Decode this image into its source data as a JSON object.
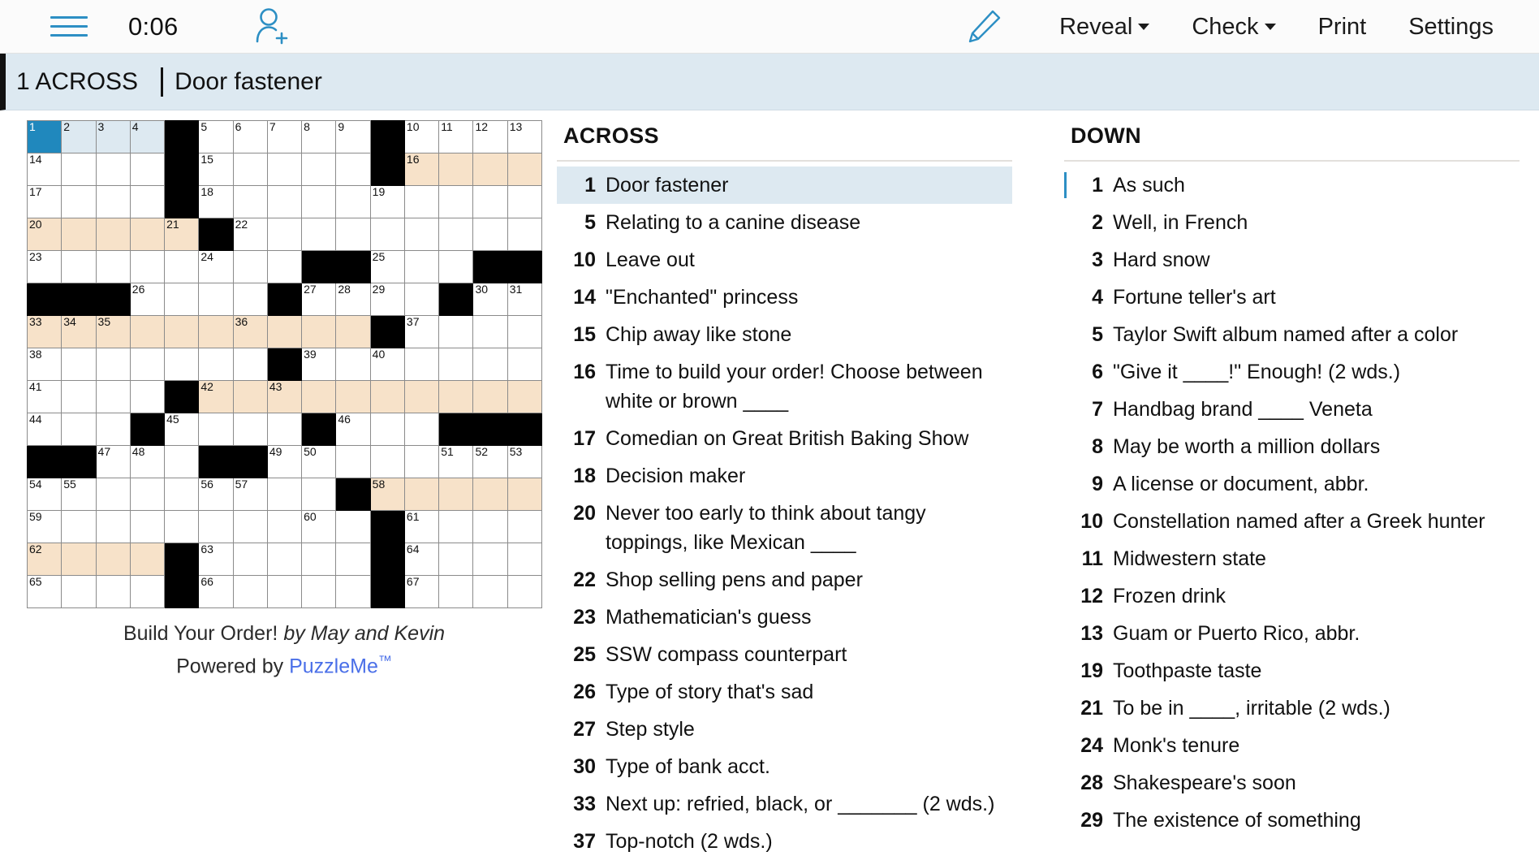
{
  "toolbar": {
    "menu_icon": "hamburger-menu-icon",
    "timer": "0:06",
    "invite_icon": "add-person-icon",
    "pencil_icon": "pencil-icon",
    "reveal_label": "Reveal",
    "check_label": "Check",
    "print_label": "Print",
    "settings_label": "Settings"
  },
  "clue_bar": {
    "number": "1 ACROSS",
    "text": "Door fastener"
  },
  "grid": {
    "rows": 15,
    "cols": 15,
    "colors": {
      "block": "#000000",
      "shade": "#f7e2c9",
      "highlight": "#dde9f1",
      "cursor": "#2088bd"
    },
    "cells": [
      [
        {
          "n": "1",
          "s": "cur"
        },
        {
          "n": "2",
          "s": "hl"
        },
        {
          "n": "3",
          "s": "hl"
        },
        {
          "n": "4",
          "s": "hl"
        },
        {
          "s": "block"
        },
        {
          "n": "5"
        },
        {
          "n": "6"
        },
        {
          "n": "7"
        },
        {
          "n": "8"
        },
        {
          "n": "9"
        },
        {
          "s": "block"
        },
        {
          "n": "10"
        },
        {
          "n": "11"
        },
        {
          "n": "12"
        },
        {
          "n": "13"
        }
      ],
      [
        {
          "n": "14"
        },
        {},
        {},
        {},
        {
          "s": "block"
        },
        {
          "n": "15"
        },
        {},
        {},
        {},
        {},
        {
          "s": "block"
        },
        {
          "n": "16",
          "s": "shade"
        },
        {
          "s": "shade"
        },
        {
          "s": "shade"
        },
        {
          "s": "shade"
        }
      ],
      [
        {
          "n": "17"
        },
        {},
        {},
        {},
        {
          "s": "block"
        },
        {
          "n": "18"
        },
        {},
        {},
        {},
        {},
        {
          "n": "19"
        },
        {},
        {},
        {},
        {}
      ],
      [
        {
          "n": "20",
          "s": "shade"
        },
        {
          "s": "shade"
        },
        {
          "s": "shade"
        },
        {
          "s": "shade"
        },
        {
          "n": "21",
          "s": "shade"
        },
        {
          "s": "block"
        },
        {
          "n": "22"
        },
        {},
        {},
        {},
        {},
        {},
        {},
        {},
        {}
      ],
      [
        {
          "n": "23"
        },
        {},
        {},
        {},
        {},
        {
          "n": "24"
        },
        {},
        {},
        {
          "s": "block"
        },
        {
          "s": "block"
        },
        {
          "n": "25"
        },
        {},
        {},
        {
          "s": "block"
        },
        {
          "s": "block"
        }
      ],
      [
        {
          "s": "block"
        },
        {
          "s": "block"
        },
        {
          "s": "block"
        },
        {
          "n": "26"
        },
        {},
        {},
        {},
        {
          "s": "block"
        },
        {
          "n": "27"
        },
        {
          "n": "28"
        },
        {
          "n": "29"
        },
        {},
        {
          "s": "block"
        },
        {
          "n": "30"
        },
        {
          "n": "31"
        }
      ],
      [
        {
          "n": "33",
          "s": "shade"
        },
        {
          "n": "34",
          "s": "shade"
        },
        {
          "n": "35",
          "s": "shade"
        },
        {
          "s": "shade"
        },
        {
          "s": "shade"
        },
        {
          "s": "shade"
        },
        {
          "n": "36",
          "s": "shade"
        },
        {
          "s": "shade"
        },
        {
          "s": "shade"
        },
        {
          "s": "shade"
        },
        {
          "s": "block"
        },
        {
          "n": "37"
        },
        {},
        {},
        {}
      ],
      [
        {
          "n": "38"
        },
        {},
        {},
        {},
        {},
        {},
        {},
        {
          "s": "block"
        },
        {
          "n": "39"
        },
        {},
        {
          "n": "40"
        },
        {},
        {},
        {},
        {}
      ],
      [
        {
          "n": "41"
        },
        {},
        {},
        {},
        {
          "s": "block"
        },
        {
          "n": "42",
          "s": "shade"
        },
        {
          "s": "shade"
        },
        {
          "n": "43",
          "s": "shade"
        },
        {
          "s": "shade"
        },
        {
          "s": "shade"
        },
        {
          "s": "shade"
        },
        {
          "s": "shade"
        },
        {
          "s": "shade"
        },
        {
          "s": "shade"
        },
        {
          "s": "shade"
        }
      ],
      [
        {
          "n": "44"
        },
        {},
        {},
        {
          "s": "block"
        },
        {
          "n": "45"
        },
        {},
        {},
        {},
        {
          "s": "block"
        },
        {
          "n": "46"
        },
        {},
        {},
        {
          "s": "block"
        },
        {
          "s": "block"
        },
        {
          "s": "block"
        }
      ],
      [
        {
          "s": "block"
        },
        {
          "s": "block"
        },
        {
          "n": "47"
        },
        {
          "n": "48"
        },
        {},
        {
          "s": "block"
        },
        {
          "s": "block"
        },
        {
          "n": "49"
        },
        {
          "n": "50"
        },
        {},
        {},
        {},
        {
          "n": "51"
        },
        {
          "n": "52"
        },
        {
          "n": "53"
        }
      ],
      [
        {
          "n": "54"
        },
        {
          "n": "55"
        },
        {},
        {},
        {},
        {
          "n": "56"
        },
        {
          "n": "57"
        },
        {},
        {},
        {
          "s": "block"
        },
        {
          "n": "58",
          "s": "shade"
        },
        {
          "s": "shade"
        },
        {
          "s": "shade"
        },
        {
          "s": "shade"
        },
        {
          "s": "shade"
        }
      ],
      [
        {
          "n": "59"
        },
        {},
        {},
        {},
        {},
        {},
        {},
        {},
        {
          "n": "60"
        },
        {},
        {
          "s": "block"
        },
        {
          "n": "61"
        },
        {},
        {},
        {}
      ],
      [
        {
          "n": "62",
          "s": "shade"
        },
        {
          "s": "shade"
        },
        {
          "s": "shade"
        },
        {
          "s": "shade"
        },
        {
          "s": "block"
        },
        {
          "n": "63"
        },
        {},
        {},
        {},
        {},
        {
          "s": "block"
        },
        {
          "n": "64"
        },
        {},
        {},
        {}
      ],
      [
        {
          "n": "65"
        },
        {},
        {},
        {},
        {
          "s": "block"
        },
        {
          "n": "66"
        },
        {},
        {},
        {},
        {},
        {
          "s": "block"
        },
        {
          "n": "67"
        },
        {},
        {},
        {}
      ]
    ]
  },
  "caption": {
    "title": "Build Your Order!",
    "byline": "by May and Kevin",
    "powered_prefix": "Powered by ",
    "powered_brand": "PuzzleMe",
    "trademark": "™"
  },
  "across": {
    "heading": "ACROSS",
    "clues": [
      {
        "num": "1",
        "text": "Door fastener",
        "selected": true
      },
      {
        "num": "5",
        "text": "Relating to a canine disease"
      },
      {
        "num": "10",
        "text": "Leave out"
      },
      {
        "num": "14",
        "text": "\"Enchanted\" princess"
      },
      {
        "num": "15",
        "text": "Chip away like stone"
      },
      {
        "num": "16",
        "text": "Time to build your order! Choose between white or brown ____"
      },
      {
        "num": "17",
        "text": "Comedian on Great British Baking Show"
      },
      {
        "num": "18",
        "text": "Decision maker"
      },
      {
        "num": "20",
        "text": "Never too early to think about tangy toppings, like Mexican ____"
      },
      {
        "num": "22",
        "text": "Shop selling pens and paper"
      },
      {
        "num": "23",
        "text": "Mathematician's guess"
      },
      {
        "num": "25",
        "text": "SSW compass counterpart"
      },
      {
        "num": "26",
        "text": "Type of story that's sad"
      },
      {
        "num": "27",
        "text": "Step style"
      },
      {
        "num": "30",
        "text": "Type of bank acct."
      },
      {
        "num": "33",
        "text": "Next up: refried, black, or _______ (2 wds.)"
      },
      {
        "num": "37",
        "text": "Top-notch (2 wds.)"
      }
    ]
  },
  "down": {
    "heading": "DOWN",
    "clues": [
      {
        "num": "1",
        "text": "As such",
        "marked": true
      },
      {
        "num": "2",
        "text": "Well, in French"
      },
      {
        "num": "3",
        "text": "Hard snow"
      },
      {
        "num": "4",
        "text": "Fortune teller's art"
      },
      {
        "num": "5",
        "text": "Taylor Swift album named after a color"
      },
      {
        "num": "6",
        "text": "\"Give it ____!\" Enough! (2 wds.)"
      },
      {
        "num": "7",
        "text": "Handbag brand ____ Veneta"
      },
      {
        "num": "8",
        "text": "May be worth a million dollars"
      },
      {
        "num": "9",
        "text": "A license or document, abbr."
      },
      {
        "num": "10",
        "text": "Constellation named after a Greek hunter"
      },
      {
        "num": "11",
        "text": "Midwestern state"
      },
      {
        "num": "12",
        "text": "Frozen drink"
      },
      {
        "num": "13",
        "text": "Guam or Puerto Rico, abbr."
      },
      {
        "num": "19",
        "text": "Toothpaste taste"
      },
      {
        "num": "21",
        "text": "To be in ____, irritable (2 wds.)"
      },
      {
        "num": "24",
        "text": "Monk's tenure"
      },
      {
        "num": "28",
        "text": "Shakespeare's soon"
      },
      {
        "num": "29",
        "text": "The existence of something"
      }
    ]
  }
}
